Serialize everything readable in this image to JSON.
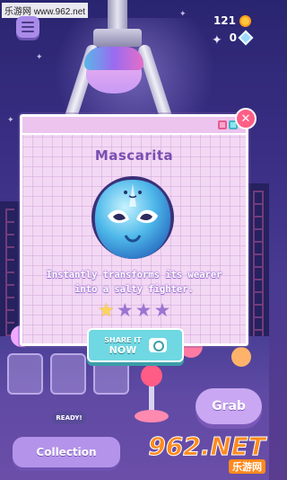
{
  "watermark": "乐游网 www.962.net",
  "currency": {
    "coins": "121",
    "gems": "0"
  },
  "modal": {
    "title": "Mascarita",
    "description": "Instantly transforms its wearer into a salty fighter.",
    "rating": 1,
    "rating_max": 5,
    "share": {
      "line1": "SHARE IT",
      "line2": "NOW"
    }
  },
  "bottom": {
    "ready_label": "READY!",
    "collection_label": "Collection",
    "grab_label": "Grab"
  },
  "logo": {
    "big": "962.NET",
    "small": "乐游网"
  },
  "colors": {
    "accent": "#7a4fb1",
    "card_bg": "#f3d8f4",
    "star_on": "#ffd45a",
    "star_off": "#9c74d2",
    "share_btn": "#6fd8e2",
    "close_btn": "#ff5f86"
  },
  "icons": [
    "menu-icon",
    "coin-icon",
    "gem-icon",
    "close-icon",
    "camera-icon",
    "star-icon"
  ]
}
